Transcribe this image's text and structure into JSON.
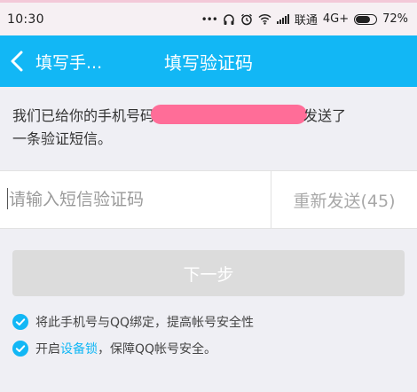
{
  "status_bar": {
    "time": "10:30",
    "dots": "•••",
    "carrier": "联通",
    "network": "4G+",
    "battery": "72%"
  },
  "header": {
    "back_label": "填写手...",
    "title": "填写验证码"
  },
  "info": {
    "line_prefix": "我们已给你的手机号码",
    "line_suffix": "发送了",
    "line2": "一条验证短信。"
  },
  "code_input": {
    "placeholder": "请输入短信验证码",
    "value": ""
  },
  "resend": {
    "label": "重新发送(45)"
  },
  "next_button": {
    "label": "下一步"
  },
  "options": {
    "bind_qq": "将此手机号与QQ绑定，提高帐号安全性",
    "device_lock_prefix": "开启",
    "device_lock_link": "设备锁",
    "device_lock_suffix": "，保障QQ帐号安全。"
  },
  "colors": {
    "accent": "#12b7f5",
    "redaction": "#ff6d98"
  }
}
